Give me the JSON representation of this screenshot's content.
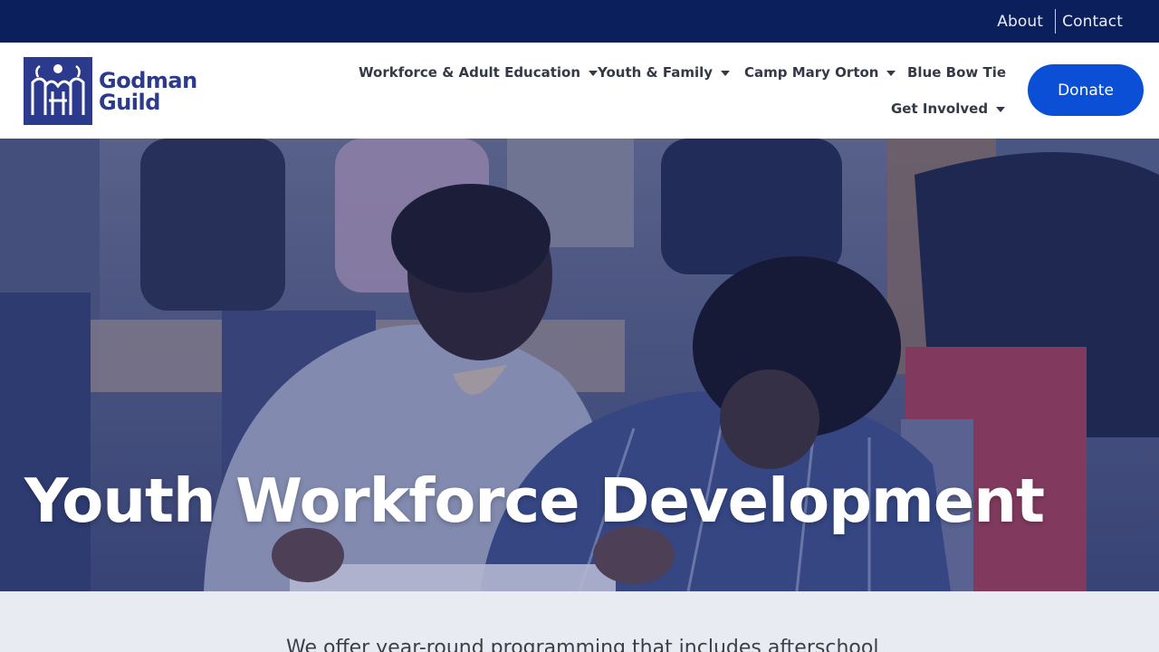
{
  "topbar": {
    "about": "About",
    "contact": "Contact",
    "bg_color": "#0b1f5c"
  },
  "logo": {
    "line1": "Godman",
    "line2": "Guild",
    "brand_color": "#2b3a8c"
  },
  "nav": {
    "items": [
      {
        "label": "Workforce & Adult Education",
        "dropdown": true
      },
      {
        "label": "Youth & Family",
        "dropdown": true
      },
      {
        "label": "Camp Mary Orton",
        "dropdown": true
      },
      {
        "label": "Blue Bow Tie",
        "dropdown": false
      },
      {
        "label": "Get Involved",
        "dropdown": true
      }
    ],
    "caret_icon": "chevron-down-icon"
  },
  "donate": {
    "label": "Donate",
    "color": "#0a4fd6"
  },
  "hero": {
    "title": "Youth Workforce Development",
    "overlay_color": "#2c3e8f"
  },
  "intro": {
    "text": "We offer year-round programming that includes afterschool"
  }
}
